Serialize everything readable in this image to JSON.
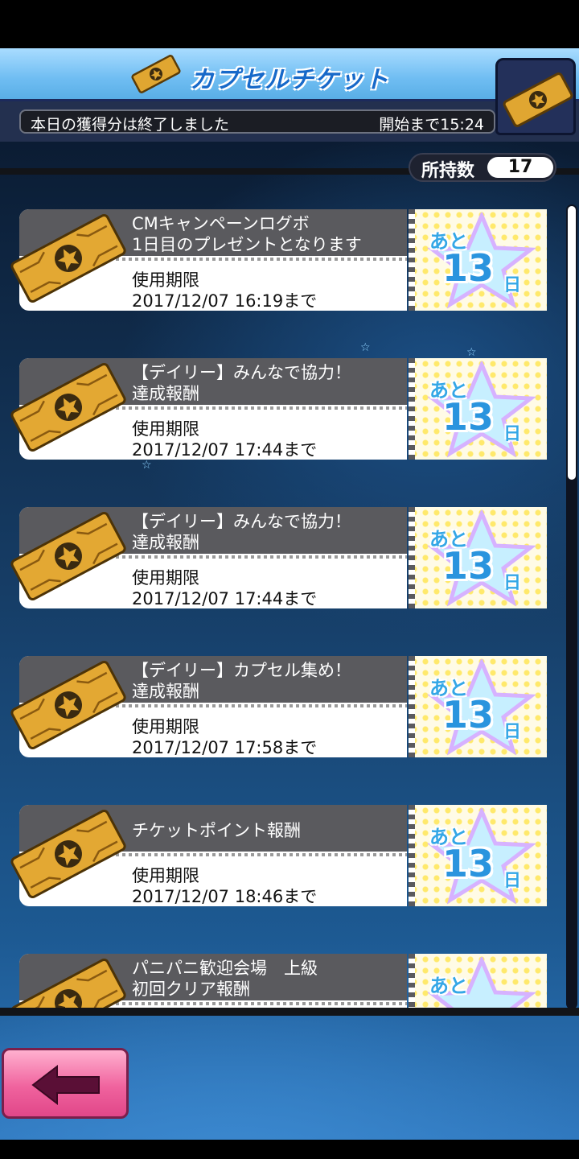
{
  "header": {
    "title": "カプセルチケット",
    "status_text": "本日の獲得分は終了しました",
    "countdown_text": "開始まで15:24"
  },
  "owned": {
    "label": "所持数",
    "count": "17"
  },
  "tickets": [
    {
      "title_lines": [
        "CMキャンペーンログボ",
        "1日目のプレゼントとなります"
      ],
      "expiry_label": "使用期限",
      "expiry": "2017/12/07 16:19まで",
      "days_prefix": "あと",
      "days": "13",
      "days_unit": "日"
    },
    {
      "title_lines": [
        "【デイリー】みんなで協力！",
        "達成報酬"
      ],
      "expiry_label": "使用期限",
      "expiry": "2017/12/07 17:44まで",
      "days_prefix": "あと",
      "days": "13",
      "days_unit": "日"
    },
    {
      "title_lines": [
        "【デイリー】みんなで協力！",
        "達成報酬"
      ],
      "expiry_label": "使用期限",
      "expiry": "2017/12/07 17:44まで",
      "days_prefix": "あと",
      "days": "13",
      "days_unit": "日"
    },
    {
      "title_lines": [
        "【デイリー】カプセル集め！",
        "達成報酬"
      ],
      "expiry_label": "使用期限",
      "expiry": "2017/12/07 17:58まで",
      "days_prefix": "あと",
      "days": "13",
      "days_unit": "日"
    },
    {
      "title_lines": [
        "チケットポイント報酬"
      ],
      "expiry_label": "使用期限",
      "expiry": "2017/12/07 18:46まで",
      "days_prefix": "あと",
      "days": "13",
      "days_unit": "日"
    },
    {
      "title_lines": [
        "パニパニ歓迎会場　上級",
        "初回クリア報酬"
      ],
      "expiry_label": "",
      "expiry": "",
      "days_prefix": "あと",
      "days": "",
      "days_unit": ""
    }
  ],
  "icons": {
    "ticket": "ticket-icon",
    "back": "back-arrow-icon"
  },
  "colors": {
    "header": "#6fbdf2",
    "title": "#1769c9",
    "back_button": "#f0639e",
    "days": "#2a94de"
  }
}
